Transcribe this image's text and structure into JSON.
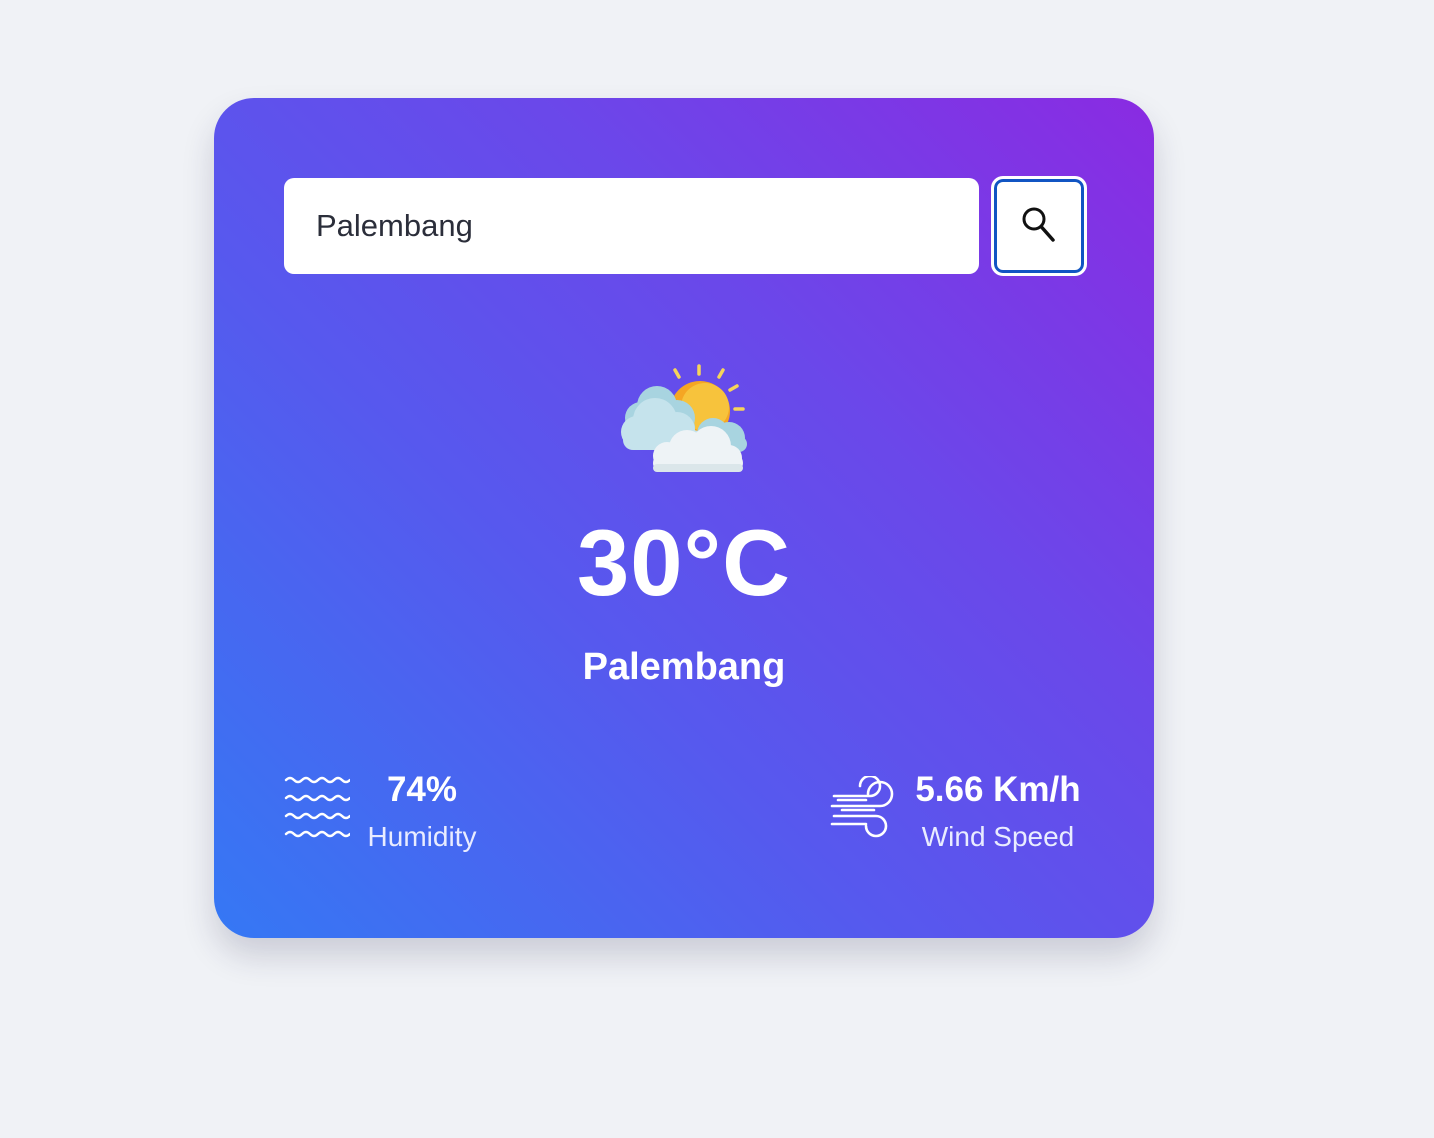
{
  "search": {
    "value": "Palembang",
    "icon": "search-icon"
  },
  "weather": {
    "icon": "partly-cloudy-icon",
    "temperature": "30°C",
    "city": "Palembang"
  },
  "humidity": {
    "icon": "humidity-waves-icon",
    "value": "74%",
    "label": "Humidity"
  },
  "wind": {
    "icon": "wind-icon",
    "value": "5.66 Km/h",
    "label": "Wind Speed"
  },
  "colors": {
    "page_background": "#f0f2f6",
    "gradient_start": "#8a2be2",
    "gradient_end": "#3578f4",
    "button_focus_ring": "#1155c3"
  }
}
